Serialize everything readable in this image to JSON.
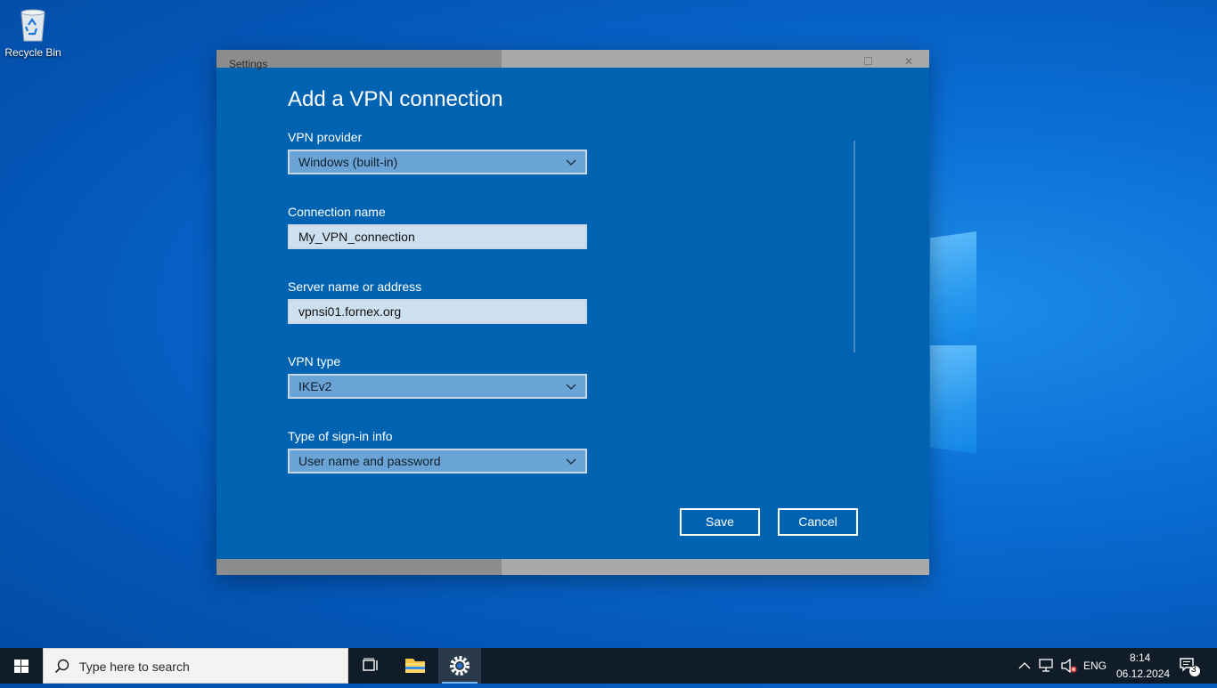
{
  "desktop": {
    "recycle_bin_label": "Recycle Bin"
  },
  "window": {
    "title": "Settings",
    "heading": "Add a VPN connection",
    "fields": {
      "vpn_provider": {
        "label": "VPN provider",
        "value": "Windows (built-in)"
      },
      "connection_name": {
        "label": "Connection name",
        "value": "My_VPN_connection"
      },
      "server": {
        "label": "Server name or address",
        "value": "vpnsi01.fornex.org"
      },
      "vpn_type": {
        "label": "VPN type",
        "value": "IKEv2"
      },
      "signin_type": {
        "label": "Type of sign-in info",
        "value": "User name and password"
      }
    },
    "buttons": {
      "save": "Save",
      "cancel": "Cancel"
    }
  },
  "taskbar": {
    "search_placeholder": "Type here to search",
    "language": "ENG",
    "time": "8:14",
    "date": "06.12.2024",
    "notification_count": "3"
  },
  "colors": {
    "window_bg": "#0063b1",
    "dropdown_bg": "#6aa4d6",
    "textbox_bg": "#cde0ef",
    "taskbar_bg": "#101c28"
  }
}
